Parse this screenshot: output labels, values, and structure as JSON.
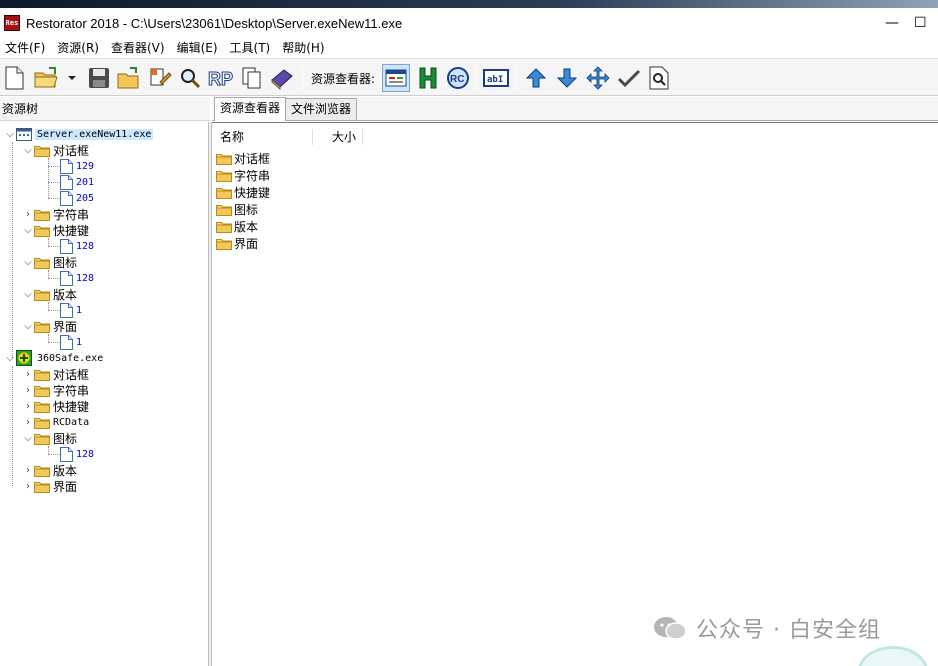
{
  "window": {
    "app_icon_text": "Res",
    "title": "Restorator 2018 - C:\\Users\\23061\\Desktop\\Server.exeNew11.exe",
    "minimize": "—",
    "maximize": "☐"
  },
  "menu": [
    "文件(F)",
    "资源(R)",
    "查看器(V)",
    "编辑(E)",
    "工具(T)",
    "帮助(H)"
  ],
  "toolbar": {
    "viewer_label": "资源查看器:",
    "buttons": [
      "new-file",
      "open-file",
      "open-dropdown",
      "save",
      "open-folder",
      "edit-resource",
      "search",
      "rp",
      "copy",
      "book",
      "view-resource",
      "hex-view",
      "rc-view",
      "text-view",
      "up",
      "down",
      "move",
      "check",
      "find"
    ]
  },
  "left_pane": {
    "header": "资源树"
  },
  "tabs": [
    "资源查看器",
    "文件浏览器"
  ],
  "tree": {
    "server": {
      "label": "Server.exeNew11.exe",
      "dialog": {
        "label": "对话框",
        "items": [
          "129",
          "201",
          "205"
        ]
      },
      "string": {
        "label": "字符串"
      },
      "accelerator": {
        "label": "快捷键",
        "items": [
          "128"
        ]
      },
      "icon": {
        "label": "图标",
        "items": [
          "128"
        ]
      },
      "version": {
        "label": "版本",
        "items": [
          "1"
        ]
      },
      "ui": {
        "label": "界面",
        "items": [
          "1"
        ]
      }
    },
    "safe360": {
      "label": "360Safe.exe",
      "dialog": {
        "label": "对话框"
      },
      "string": {
        "label": "字符串"
      },
      "accelerator": {
        "label": "快捷键"
      },
      "rcdata": {
        "label": "RCData"
      },
      "icon": {
        "label": "图标",
        "items": [
          "128"
        ]
      },
      "version": {
        "label": "版本"
      },
      "ui": {
        "label": "界面"
      }
    }
  },
  "list": {
    "columns": {
      "name": "名称",
      "size": "大小"
    },
    "rows": [
      "对话框",
      "字符串",
      "快捷键",
      "图标",
      "版本",
      "界面"
    ]
  },
  "watermark": {
    "text": "公众号 · 白安全组"
  },
  "colors": {
    "selection": "#cce8ff",
    "leaf_text": "#0000cc",
    "folder": "#f3c85a",
    "accent": "#0b6bcb"
  }
}
